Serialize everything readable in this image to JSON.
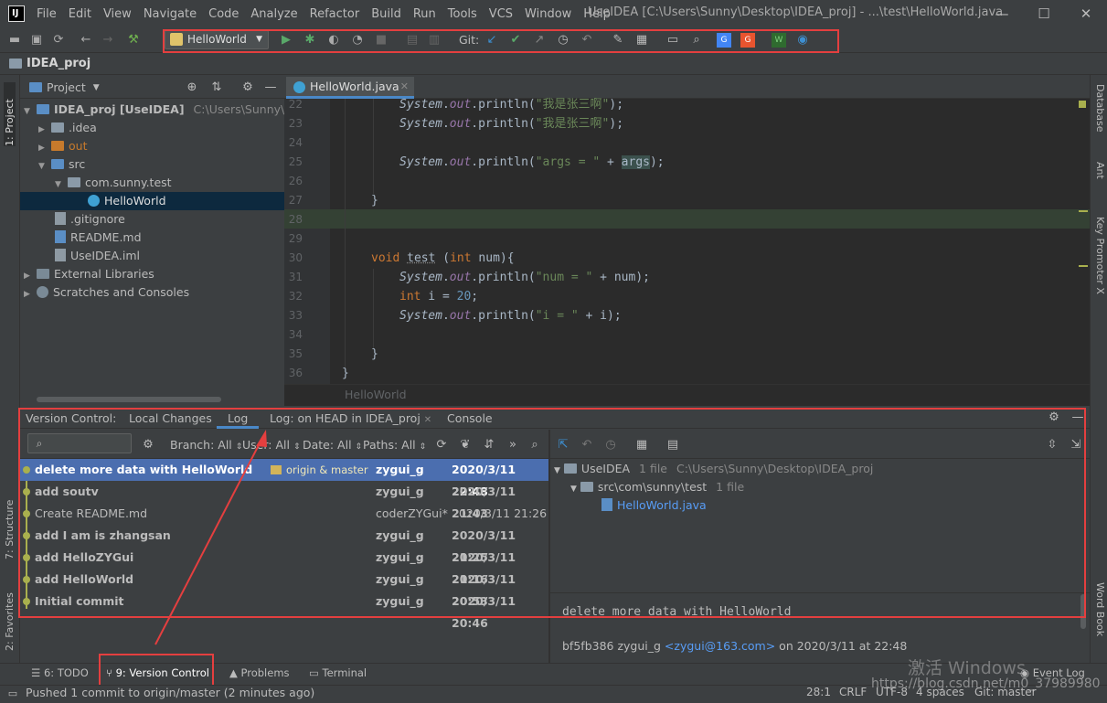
{
  "app": {
    "logo": "IJ",
    "window_title": "UseIDEA [C:\\Users\\Sunny\\Desktop\\IDEA_proj] - ...\\test\\HelloWorld.java",
    "menu": [
      "File",
      "Edit",
      "View",
      "Navigate",
      "Code",
      "Analyze",
      "Refactor",
      "Build",
      "Run",
      "Tools",
      "VCS",
      "Window",
      "Help"
    ],
    "window_controls": [
      "—",
      "☐",
      "✕"
    ]
  },
  "toolbar": {
    "run_config": "HelloWorld",
    "git_label": "Git:"
  },
  "breadcrumb": "IDEA_proj",
  "left_strip": {
    "project": "1: Project",
    "structure": "7: Structure",
    "favorites": "2: Favorites"
  },
  "right_strip": {
    "database": "Database",
    "ant": "Ant",
    "key_promoter": "Key Promoter X",
    "word_book": "Word Book"
  },
  "project_panel": {
    "title": "Project",
    "tree": [
      {
        "label": "IDEA_proj [UseIDEA]",
        "extra": "C:\\Users\\Sunny\\Desk"
      },
      {
        "label": ".idea"
      },
      {
        "label": "out"
      },
      {
        "label": "src"
      },
      {
        "label": "com.sunny.test"
      },
      {
        "label": "HelloWorld"
      },
      {
        "label": ".gitignore"
      },
      {
        "label": "README.md"
      },
      {
        "label": "UseIDEA.iml"
      },
      {
        "label": "External Libraries"
      },
      {
        "label": "Scratches and Consoles"
      }
    ]
  },
  "editor": {
    "tab": "HelloWorld.java",
    "footer": "HelloWorld",
    "line_numbers": [
      "22",
      "23",
      "24",
      "25",
      "26",
      "27",
      "28",
      "29",
      "30",
      "31",
      "32",
      "33",
      "34",
      "35",
      "36"
    ]
  },
  "vc": {
    "tabs": [
      "Version Control:",
      "Local Changes",
      "Log",
      "Log: on HEAD in IDEA_proj",
      "Console"
    ],
    "filters": {
      "branch": "Branch: All",
      "user": "User: All",
      "date": "Date: All",
      "paths": "Paths: All"
    },
    "commits": [
      {
        "msg": "delete more data with HelloWorld",
        "tag": "origin & master",
        "author": "zygui_g",
        "date": "2020/3/11 22:48"
      },
      {
        "msg": "add soutv",
        "author": "zygui_g",
        "date": "2020/3/11 21:43"
      },
      {
        "msg": "Create README.md",
        "author": "coderZYGui*",
        "date": "2020/3/11 21:26"
      },
      {
        "msg": "add I am is zhangsan",
        "author": "zygui_g",
        "date": "2020/3/11 21:25"
      },
      {
        "msg": "add HelloZYGui",
        "author": "zygui_g",
        "date": "2020/3/11 21:16"
      },
      {
        "msg": "add HelloWorld",
        "author": "zygui_g",
        "date": "2020/3/11 20:53"
      },
      {
        "msg": "Initial commit",
        "author": "zygui_g",
        "date": "2020/3/11 20:46"
      }
    ],
    "changes": {
      "root": "UseIDEA",
      "root_count": "1 file",
      "root_path": "C:\\Users\\Sunny\\Desktop\\IDEA_proj",
      "dir": "src\\com\\sunny\\test",
      "dir_count": "1 file",
      "file": "HelloWorld.java"
    },
    "details": {
      "message": "delete more data with HelloWorld",
      "hash_author": "bf5fb386 zygui_g",
      "email": "<zygui@163.com>",
      "on": "on 2020/3/11 at 22:48"
    }
  },
  "bottom_tools": {
    "todo": "6: TODO",
    "version_control": "9: Version Control",
    "problems": "Problems",
    "terminal": "Terminal",
    "event_log": "Event Log"
  },
  "status": {
    "message": "Pushed 1 commit to origin/master (2 minutes ago)",
    "position": "28:1",
    "line_sep": "CRLF",
    "encoding": "UTF-8",
    "indent": "4 spaces",
    "branch": "Git: master"
  },
  "watermark": {
    "line1": "激活 Windows",
    "line2": "https://blog.csdn.net/m0_37989980"
  }
}
